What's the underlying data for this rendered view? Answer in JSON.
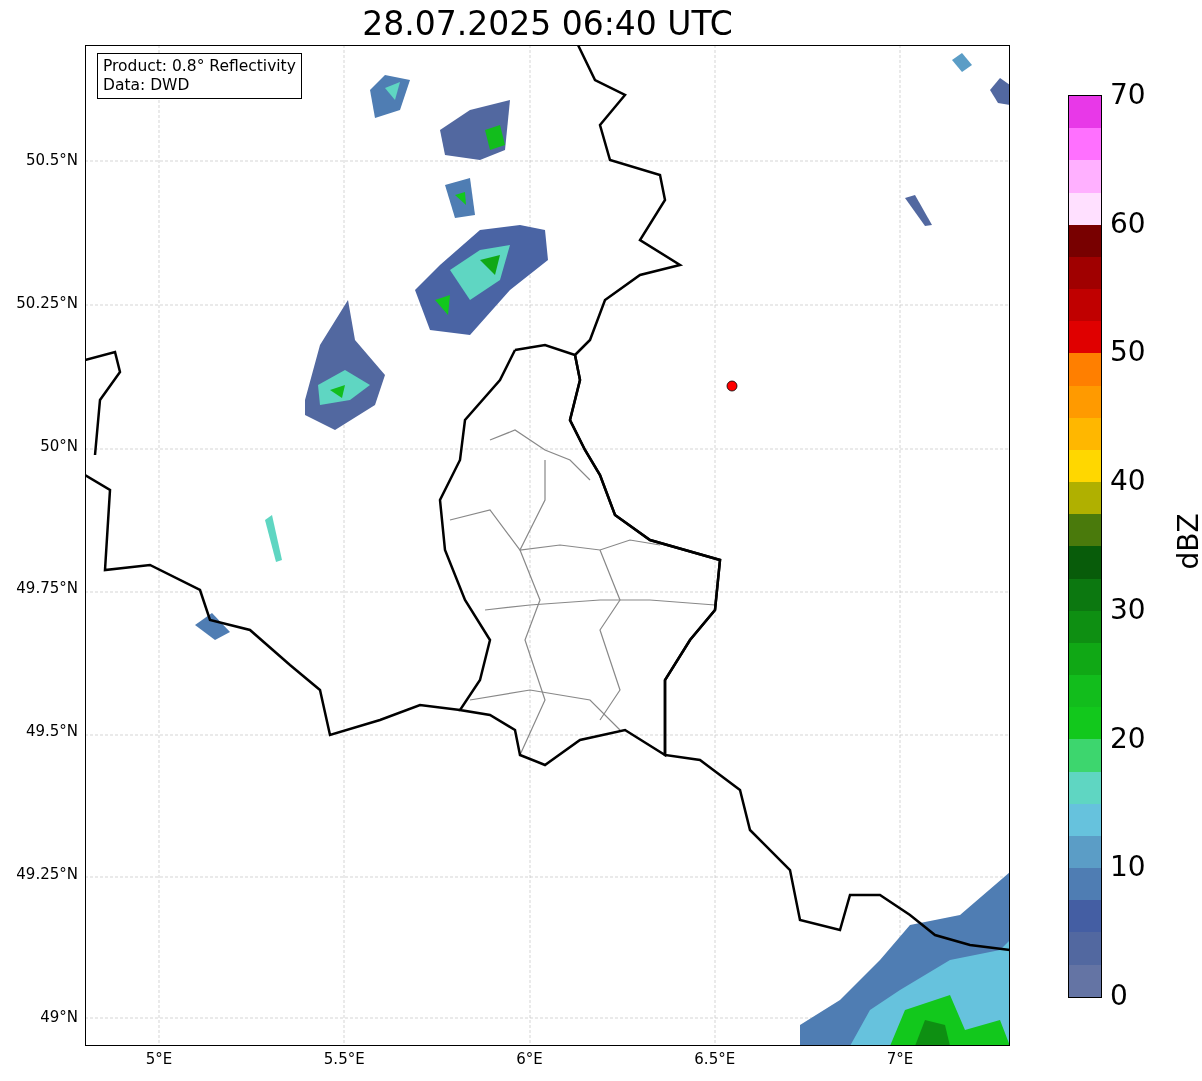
{
  "title": "28.07.2025 06:40 UTC",
  "info_box": {
    "lines": [
      "Product: 0.8° Reflectivity",
      "Data: DWD"
    ]
  },
  "map": {
    "x_ticks": [
      "5°E",
      "5.5°E",
      "6°E",
      "6.5°E",
      "7°E"
    ],
    "y_ticks": [
      "50.5°N",
      "50.25°N",
      "50°N",
      "49.75°N",
      "49.5°N",
      "49.25°N",
      "49°N"
    ]
  },
  "colorbar": {
    "label": "dBZ",
    "ticks": [
      "70",
      "60",
      "50",
      "40",
      "30",
      "20",
      "10",
      "0"
    ],
    "bins": [
      {
        "color": "#e838e8"
      },
      {
        "color": "#ff70ff"
      },
      {
        "color": "#ffb0ff"
      },
      {
        "color": "#ffe0ff"
      },
      {
        "color": "#780000"
      },
      {
        "color": "#a00000"
      },
      {
        "color": "#c00000"
      },
      {
        "color": "#e00000"
      },
      {
        "color": "#ff7f00"
      },
      {
        "color": "#ff9a00"
      },
      {
        "color": "#ffb700"
      },
      {
        "color": "#ffd700"
      },
      {
        "color": "#b0b000"
      },
      {
        "color": "#4a7a0c"
      },
      {
        "color": "#085c0a"
      },
      {
        "color": "#0c7810"
      },
      {
        "color": "#0e8f12"
      },
      {
        "color": "#10a815"
      },
      {
        "color": "#12bd1c"
      },
      {
        "color": "#12c81c"
      },
      {
        "color": "#3dd66e"
      },
      {
        "color": "#5fd6c2"
      },
      {
        "color": "#66c2dd"
      },
      {
        "color": "#5b9dc6"
      },
      {
        "color": "#4f7db3"
      },
      {
        "color": "#445ea3"
      },
      {
        "color": "#5268a0"
      },
      {
        "color": "#6474a4"
      }
    ]
  }
}
